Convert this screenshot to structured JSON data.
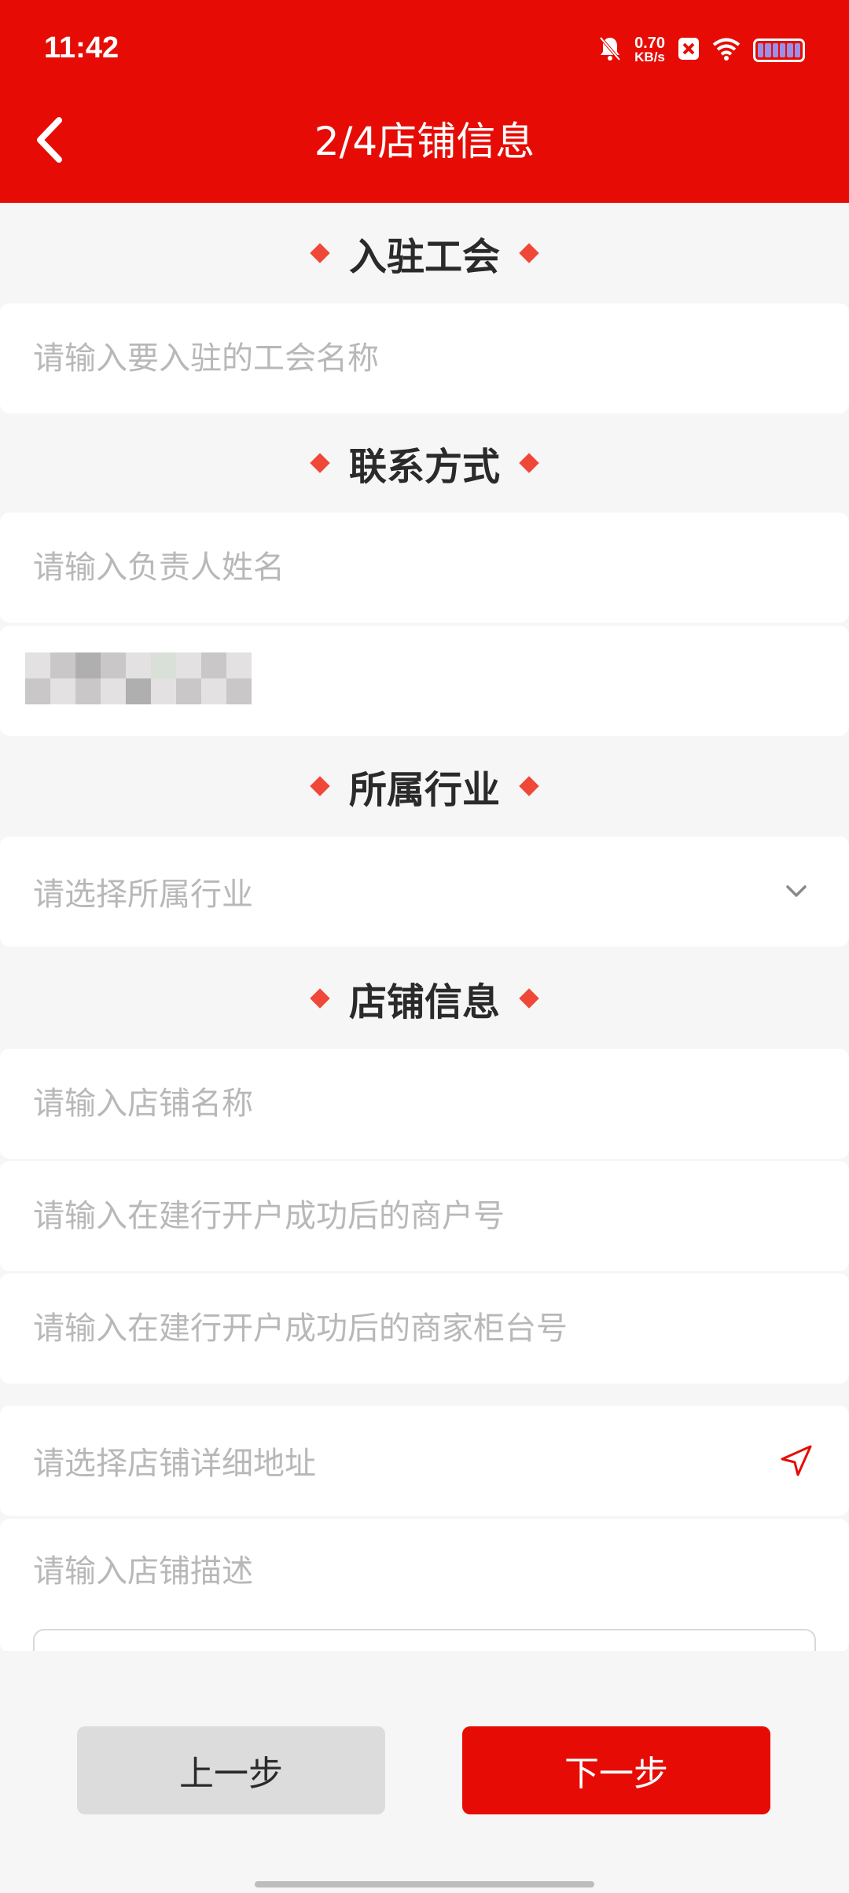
{
  "status_bar": {
    "time": "11:42",
    "net_speed": "0.70",
    "net_unit": "KB/s",
    "icons": [
      "bell-muted-icon",
      "close-box-icon",
      "wifi-icon",
      "battery-icon"
    ]
  },
  "header": {
    "back_icon": "chevron-left-icon",
    "title": "2/4店铺信息",
    "bg_color": "#e60c05"
  },
  "sections": {
    "union": {
      "title": "入驻工会"
    },
    "contact": {
      "title": "联系方式"
    },
    "industry": {
      "title": "所属行业"
    },
    "store": {
      "title": "店铺信息"
    }
  },
  "fields": {
    "union_name": {
      "placeholder": "请输入要入驻的工会名称",
      "value": ""
    },
    "contact_name": {
      "placeholder": "请输入负责人姓名",
      "value": ""
    },
    "industry": {
      "placeholder": "请选择所属行业",
      "icon": "chevron-down-icon"
    },
    "store_name": {
      "placeholder": "请输入店铺名称",
      "value": ""
    },
    "merchant_no": {
      "placeholder": "请输入在建行开户成功后的商户号",
      "value": ""
    },
    "counter_no": {
      "placeholder": "请输入在建行开户成功后的商家柜台号",
      "value": ""
    },
    "address": {
      "placeholder": "请选择店铺详细地址",
      "icon": "location-arrow-icon"
    },
    "description": {
      "placeholder": "请输入店铺描述",
      "value": ""
    }
  },
  "buttons": {
    "prev": "上一步",
    "next": "下一步"
  },
  "colors": {
    "accent": "#e60c05",
    "diamond": "#f04838",
    "placeholder": "#b8b8b8"
  }
}
